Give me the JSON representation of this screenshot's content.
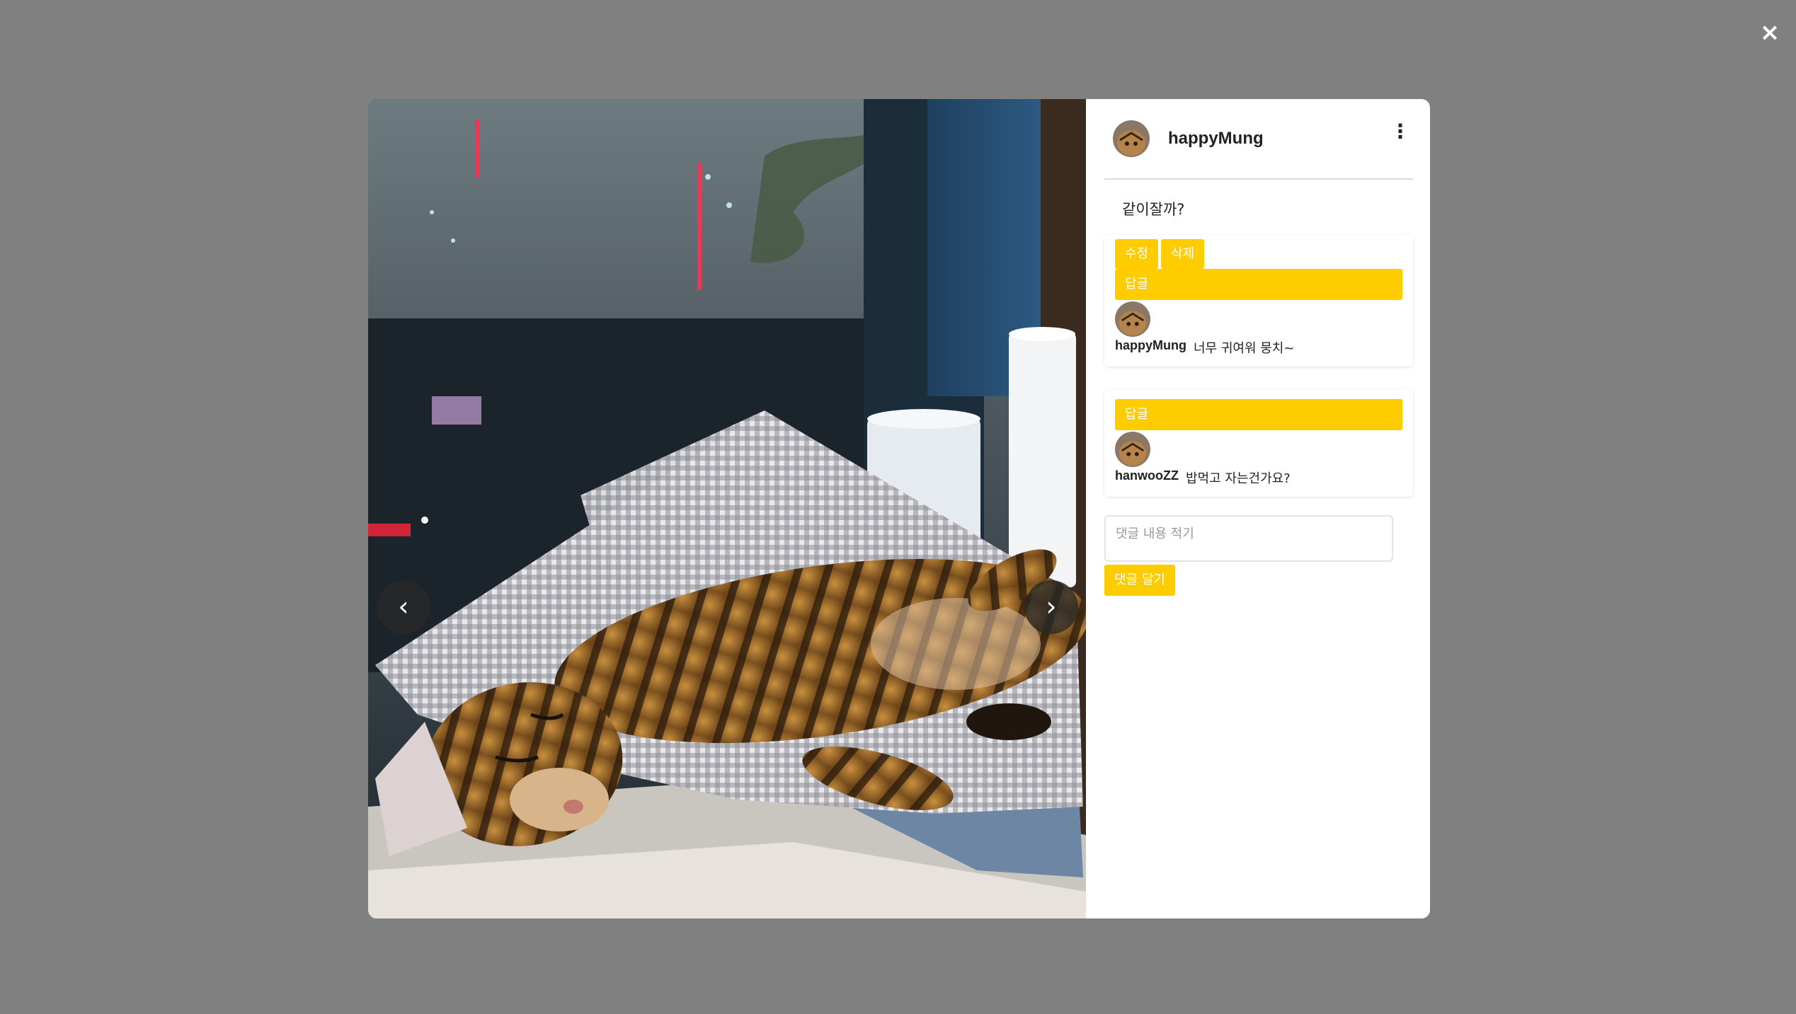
{
  "close_icon": "×",
  "photo": {
    "prev_icon": "‹",
    "next_icon": "›"
  },
  "post": {
    "author": "happyMung",
    "more_icon": "⋮",
    "caption": "같이잘까?"
  },
  "comments": [
    {
      "edit_label": "수정",
      "delete_label": "삭제",
      "reply_label": "답글",
      "user": "happyMung",
      "text": "너무 귀여워 뭉치~"
    },
    {
      "reply_label": "답글",
      "user": "hanwooZZ",
      "text": "밥먹고 자는건가요?"
    }
  ],
  "comment_form": {
    "placeholder": "댓글 내용 적기",
    "submit_label": "댓글 달기"
  },
  "colors": {
    "accent": "#ffcc00",
    "overlay": "#808080"
  }
}
